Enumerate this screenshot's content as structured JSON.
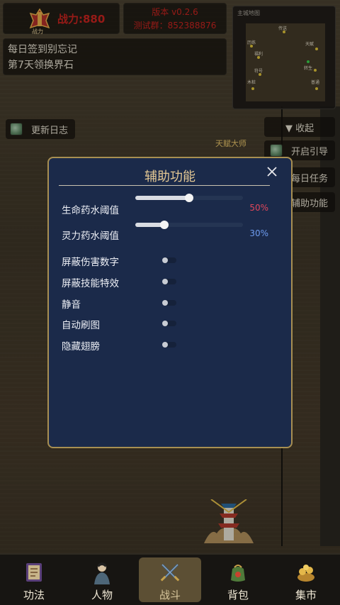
{
  "header": {
    "power_label": "战力:880",
    "power_icon_text": "战力",
    "version": "版本 v0.2.6",
    "test_group": "测试群：852388876"
  },
  "sign_in": {
    "line1": "每日签到别忘记",
    "line2": "第7天领换界石"
  },
  "minimap": {
    "title": "主城地图",
    "labels": [
      "传送",
      "历练",
      "天赋",
      "福利",
      "转生",
      "符号",
      "木桩",
      "普通"
    ]
  },
  "left_buttons": {
    "update_log": "更新日志"
  },
  "right_buttons": {
    "collapse": "▼ 收起",
    "guide": "开启引导",
    "daily": "每日任务",
    "assist": "辅助功能"
  },
  "npc": {
    "name": "天赋大师"
  },
  "modal": {
    "title": "辅助功能",
    "hp_label": "生命药水阈值",
    "hp_value": "50%",
    "hp_fraction": 0.5,
    "mp_label": "灵力药水阈值",
    "mp_value": "30%",
    "mp_fraction": 0.27,
    "toggles": [
      {
        "label": "屏蔽伤害数字",
        "on": false
      },
      {
        "label": "屏蔽技能特效",
        "on": false
      },
      {
        "label": "静音",
        "on": false
      },
      {
        "label": "自动刷图",
        "on": false
      },
      {
        "label": "隐藏翅膀",
        "on": false
      }
    ],
    "colors": {
      "hp": "#e0465a",
      "mp": "#6e9cf0",
      "title": "#e4c894"
    }
  },
  "bottom_nav": [
    {
      "label": "功法",
      "icon": "scroll-icon"
    },
    {
      "label": "人物",
      "icon": "character-icon"
    },
    {
      "label": "战斗",
      "icon": "crossed-swords-icon",
      "active": true
    },
    {
      "label": "背包",
      "icon": "bag-icon"
    },
    {
      "label": "集市",
      "icon": "market-icon"
    }
  ]
}
